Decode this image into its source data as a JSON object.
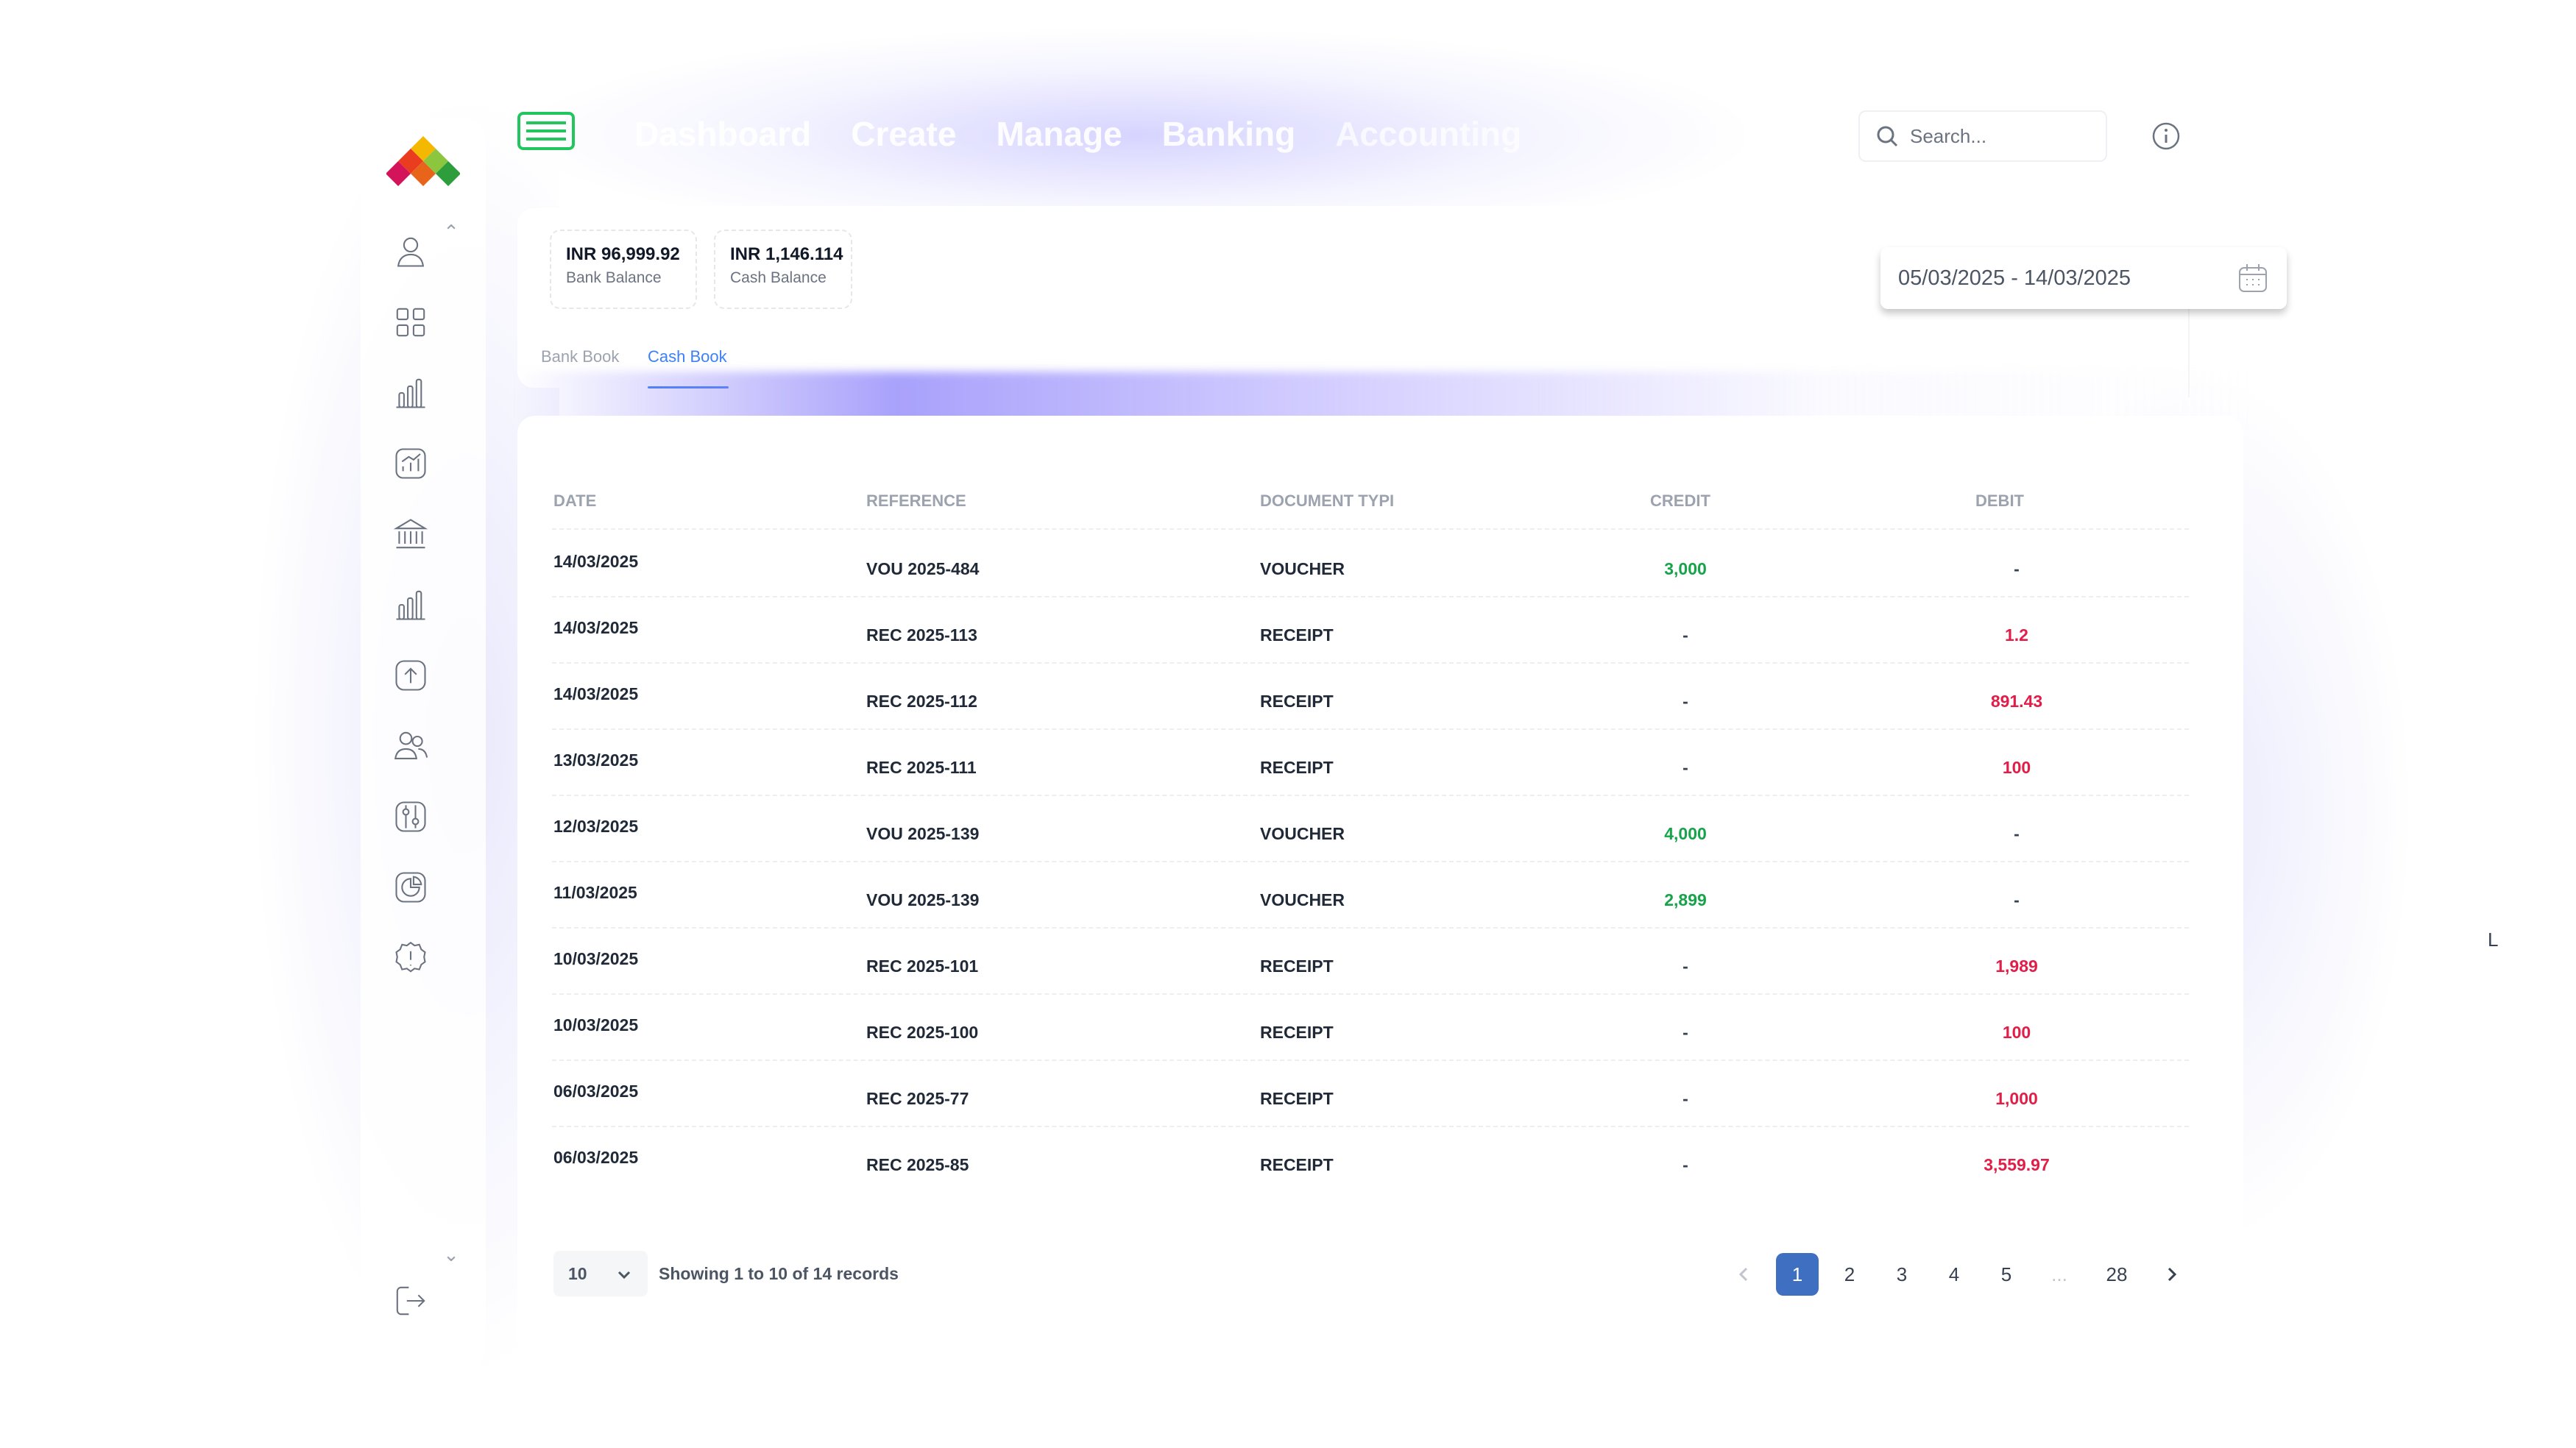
{
  "nav": {
    "items": [
      "Dashboard",
      "Create",
      "Manage",
      "Banking",
      "Accounting"
    ]
  },
  "search": {
    "placeholder": "Search..."
  },
  "balances": [
    {
      "amount": "INR 96,999.92",
      "label": "Bank Balance"
    },
    {
      "amount": "INR 1,146.114",
      "label": "Cash Balance"
    }
  ],
  "tabs": {
    "bank": "Bank Book",
    "cash": "Cash Book",
    "active": "Cash Book"
  },
  "date_range": "05/03/2025 - 14/03/2025",
  "table": {
    "columns": [
      "DATE",
      "REFERENCE",
      "DOCUMENT TYPI",
      "CREDIT",
      "DEBIT"
    ],
    "rows": [
      {
        "date": "14/03/2025",
        "reference": "VOU 2025-484",
        "document_type": "VOUCHER",
        "credit": "3,000",
        "debit": "-"
      },
      {
        "date": "14/03/2025",
        "reference": "REC 2025-113",
        "document_type": "RECEIPT",
        "credit": "-",
        "debit": "1.2"
      },
      {
        "date": "14/03/2025",
        "reference": "REC 2025-112",
        "document_type": "RECEIPT",
        "credit": "-",
        "debit": "891.43"
      },
      {
        "date": "13/03/2025",
        "reference": "REC 2025-111",
        "document_type": "RECEIPT",
        "credit": "-",
        "debit": "100"
      },
      {
        "date": "12/03/2025",
        "reference": "VOU 2025-139",
        "document_type": "VOUCHER",
        "credit": "4,000",
        "debit": "-"
      },
      {
        "date": "11/03/2025",
        "reference": "VOU 2025-139",
        "document_type": "VOUCHER",
        "credit": "2,899",
        "debit": "-"
      },
      {
        "date": "10/03/2025",
        "reference": "REC 2025-101",
        "document_type": "RECEIPT",
        "credit": "-",
        "debit": "1,989"
      },
      {
        "date": "10/03/2025",
        "reference": "REC 2025-100",
        "document_type": "RECEIPT",
        "credit": "-",
        "debit": "100"
      },
      {
        "date": "06/03/2025",
        "reference": "REC 2025-77",
        "document_type": "RECEIPT",
        "credit": "-",
        "debit": "1,000"
      },
      {
        "date": "06/03/2025",
        "reference": "REC 2025-85",
        "document_type": "RECEIPT",
        "credit": "-",
        "debit": "3,559.97"
      }
    ]
  },
  "footer": {
    "per_page": "10",
    "records_text": "Showing 1 to 10 of 14 records",
    "pages": [
      "1",
      "2",
      "3",
      "4",
      "5",
      "...",
      "28"
    ],
    "current_page": "1"
  },
  "stray_text": "L",
  "colors": {
    "accent": "#3f6fc0",
    "credit": "#16a34a",
    "debit": "#e11d48",
    "tab_active": "#3b82f6"
  },
  "icons": {
    "sidebar": [
      "user-icon",
      "grid-icon",
      "bar-chart-icon",
      "trend-chart-icon",
      "bank-icon",
      "bar-chart-icon",
      "upload-icon",
      "users-icon",
      "settings-sliders-icon",
      "pie-chart-icon",
      "alert-badge-icon"
    ],
    "logout": "logout-icon"
  }
}
